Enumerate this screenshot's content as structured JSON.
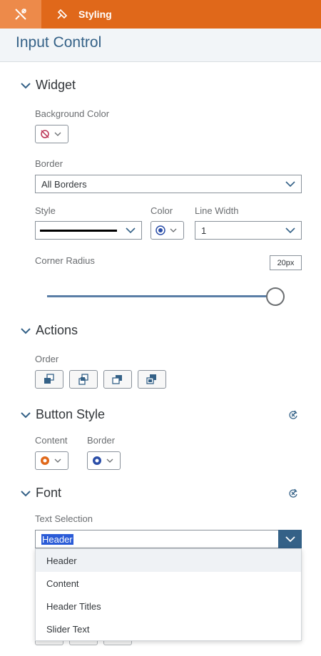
{
  "header": {
    "tab_styling_label": "Styling"
  },
  "panel": {
    "title": "Input Control"
  },
  "widget": {
    "heading": "Widget",
    "background_color_label": "Background Color",
    "border_label": "Border",
    "border_value": "All Borders",
    "style_label": "Style",
    "color_label": "Color",
    "line_width_label": "Line Width",
    "line_width_value": "1",
    "corner_radius_label": "Corner Radius",
    "corner_radius_value": "20px",
    "corner_radius_level": 1.0
  },
  "actions": {
    "heading": "Actions",
    "order_label": "Order"
  },
  "button_style": {
    "heading": "Button Style",
    "content_label": "Content",
    "border_label": "Border",
    "content_color": "#e0681a",
    "border_color": "#2b4ea8"
  },
  "font": {
    "heading": "Font",
    "text_selection_label": "Text Selection",
    "text_selection_value": "Header",
    "options": [
      "Header",
      "Content",
      "Header Titles",
      "Slider Text"
    ]
  },
  "colors": {
    "accent": "#e0681a",
    "title_blue": "#346187",
    "selection_blue": "#2a5bd7"
  }
}
